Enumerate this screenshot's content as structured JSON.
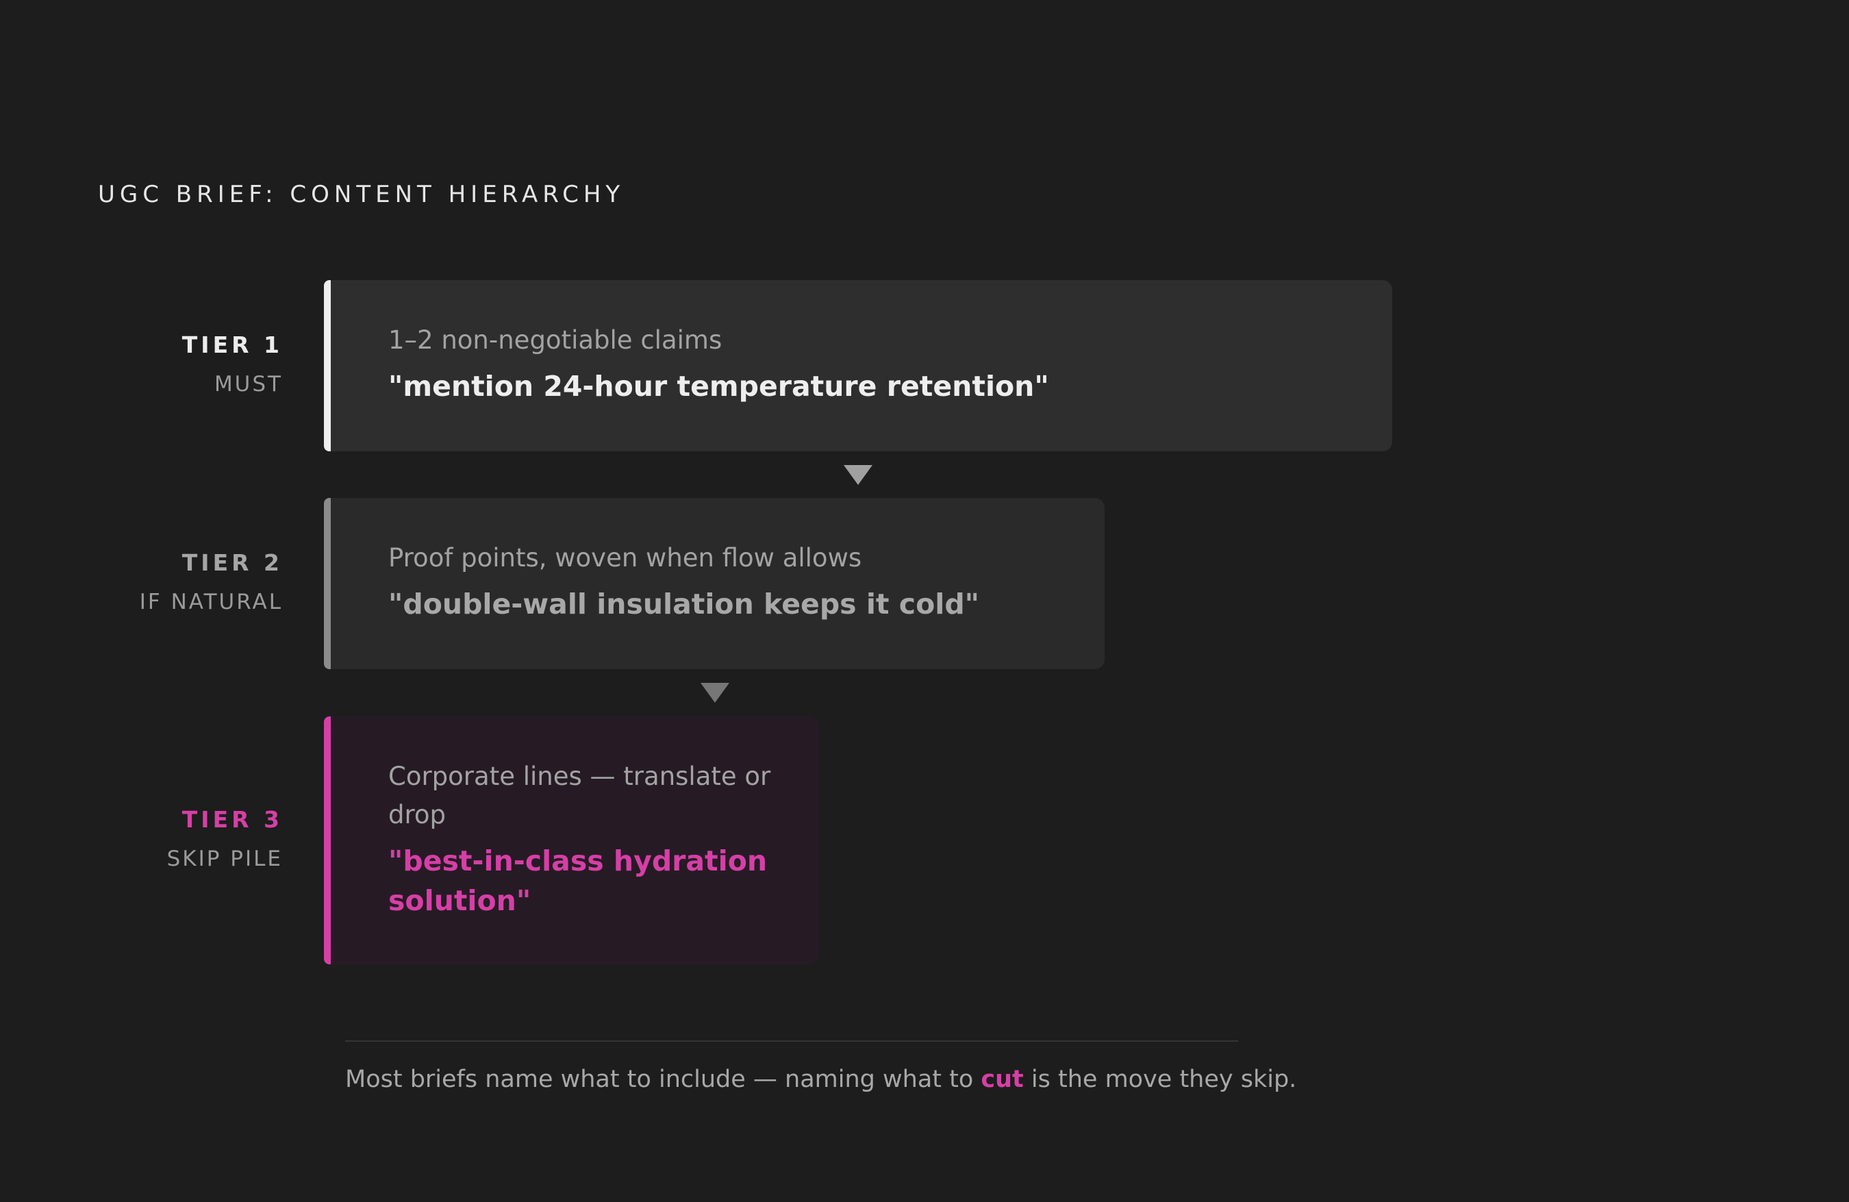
{
  "heading": "UGC BRIEF: CONTENT HIERARCHY",
  "tiers": [
    {
      "label": "TIER 1",
      "sublabel": "MUST",
      "description": "1–2 non-negotiable claims",
      "quote": "\"mention 24-hour temperature retention\"",
      "accent_color": "#eeeeee"
    },
    {
      "label": "TIER 2",
      "sublabel": "IF NATURAL",
      "description": "Proof points, woven when flow allows",
      "quote": "\"double-wall insulation keeps it cold\"",
      "accent_color": "#8c8c8c"
    },
    {
      "label": "TIER 3",
      "sublabel": "SKIP PILE",
      "description": "Corporate lines — translate or drop",
      "quote": "\"best-in-class hydration solution\"",
      "accent_color": "#d63fa6"
    }
  ],
  "footnote": {
    "before": "Most briefs name what to include — naming what to ",
    "highlight": "cut",
    "after": " is the move they skip."
  },
  "colors": {
    "background": "#1d1d1d",
    "accent": "#d63fa6"
  }
}
